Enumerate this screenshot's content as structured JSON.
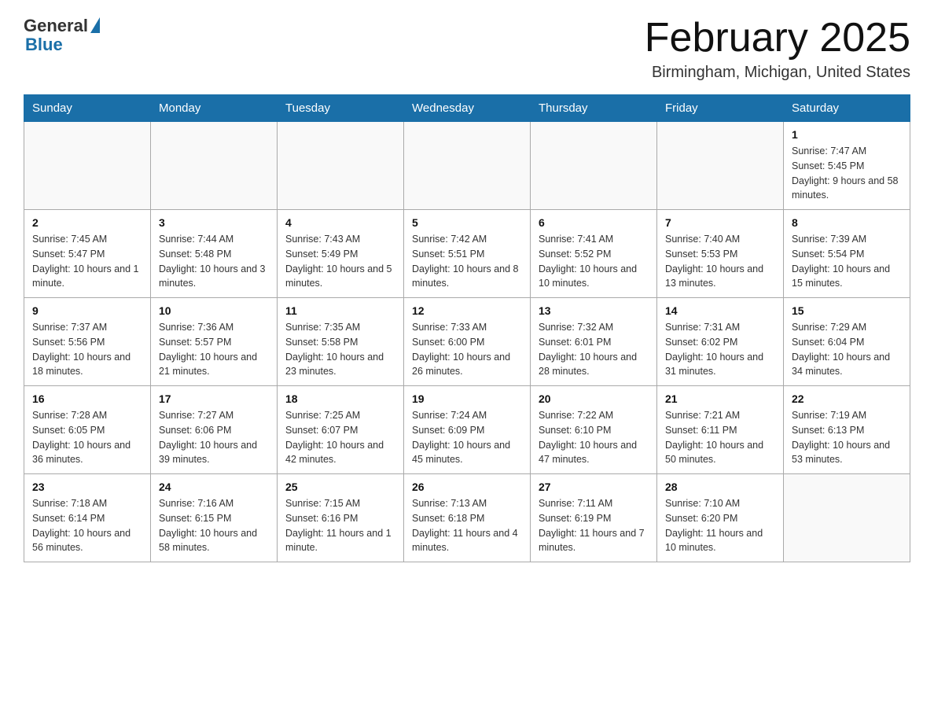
{
  "logo": {
    "general": "General",
    "blue": "Blue"
  },
  "header": {
    "month": "February 2025",
    "location": "Birmingham, Michigan, United States"
  },
  "days_of_week": [
    "Sunday",
    "Monday",
    "Tuesday",
    "Wednesday",
    "Thursday",
    "Friday",
    "Saturday"
  ],
  "weeks": [
    [
      {
        "day": "",
        "info": ""
      },
      {
        "day": "",
        "info": ""
      },
      {
        "day": "",
        "info": ""
      },
      {
        "day": "",
        "info": ""
      },
      {
        "day": "",
        "info": ""
      },
      {
        "day": "",
        "info": ""
      },
      {
        "day": "1",
        "info": "Sunrise: 7:47 AM\nSunset: 5:45 PM\nDaylight: 9 hours and 58 minutes."
      }
    ],
    [
      {
        "day": "2",
        "info": "Sunrise: 7:45 AM\nSunset: 5:47 PM\nDaylight: 10 hours and 1 minute."
      },
      {
        "day": "3",
        "info": "Sunrise: 7:44 AM\nSunset: 5:48 PM\nDaylight: 10 hours and 3 minutes."
      },
      {
        "day": "4",
        "info": "Sunrise: 7:43 AM\nSunset: 5:49 PM\nDaylight: 10 hours and 5 minutes."
      },
      {
        "day": "5",
        "info": "Sunrise: 7:42 AM\nSunset: 5:51 PM\nDaylight: 10 hours and 8 minutes."
      },
      {
        "day": "6",
        "info": "Sunrise: 7:41 AM\nSunset: 5:52 PM\nDaylight: 10 hours and 10 minutes."
      },
      {
        "day": "7",
        "info": "Sunrise: 7:40 AM\nSunset: 5:53 PM\nDaylight: 10 hours and 13 minutes."
      },
      {
        "day": "8",
        "info": "Sunrise: 7:39 AM\nSunset: 5:54 PM\nDaylight: 10 hours and 15 minutes."
      }
    ],
    [
      {
        "day": "9",
        "info": "Sunrise: 7:37 AM\nSunset: 5:56 PM\nDaylight: 10 hours and 18 minutes."
      },
      {
        "day": "10",
        "info": "Sunrise: 7:36 AM\nSunset: 5:57 PM\nDaylight: 10 hours and 21 minutes."
      },
      {
        "day": "11",
        "info": "Sunrise: 7:35 AM\nSunset: 5:58 PM\nDaylight: 10 hours and 23 minutes."
      },
      {
        "day": "12",
        "info": "Sunrise: 7:33 AM\nSunset: 6:00 PM\nDaylight: 10 hours and 26 minutes."
      },
      {
        "day": "13",
        "info": "Sunrise: 7:32 AM\nSunset: 6:01 PM\nDaylight: 10 hours and 28 minutes."
      },
      {
        "day": "14",
        "info": "Sunrise: 7:31 AM\nSunset: 6:02 PM\nDaylight: 10 hours and 31 minutes."
      },
      {
        "day": "15",
        "info": "Sunrise: 7:29 AM\nSunset: 6:04 PM\nDaylight: 10 hours and 34 minutes."
      }
    ],
    [
      {
        "day": "16",
        "info": "Sunrise: 7:28 AM\nSunset: 6:05 PM\nDaylight: 10 hours and 36 minutes."
      },
      {
        "day": "17",
        "info": "Sunrise: 7:27 AM\nSunset: 6:06 PM\nDaylight: 10 hours and 39 minutes."
      },
      {
        "day": "18",
        "info": "Sunrise: 7:25 AM\nSunset: 6:07 PM\nDaylight: 10 hours and 42 minutes."
      },
      {
        "day": "19",
        "info": "Sunrise: 7:24 AM\nSunset: 6:09 PM\nDaylight: 10 hours and 45 minutes."
      },
      {
        "day": "20",
        "info": "Sunrise: 7:22 AM\nSunset: 6:10 PM\nDaylight: 10 hours and 47 minutes."
      },
      {
        "day": "21",
        "info": "Sunrise: 7:21 AM\nSunset: 6:11 PM\nDaylight: 10 hours and 50 minutes."
      },
      {
        "day": "22",
        "info": "Sunrise: 7:19 AM\nSunset: 6:13 PM\nDaylight: 10 hours and 53 minutes."
      }
    ],
    [
      {
        "day": "23",
        "info": "Sunrise: 7:18 AM\nSunset: 6:14 PM\nDaylight: 10 hours and 56 minutes."
      },
      {
        "day": "24",
        "info": "Sunrise: 7:16 AM\nSunset: 6:15 PM\nDaylight: 10 hours and 58 minutes."
      },
      {
        "day": "25",
        "info": "Sunrise: 7:15 AM\nSunset: 6:16 PM\nDaylight: 11 hours and 1 minute."
      },
      {
        "day": "26",
        "info": "Sunrise: 7:13 AM\nSunset: 6:18 PM\nDaylight: 11 hours and 4 minutes."
      },
      {
        "day": "27",
        "info": "Sunrise: 7:11 AM\nSunset: 6:19 PM\nDaylight: 11 hours and 7 minutes."
      },
      {
        "day": "28",
        "info": "Sunrise: 7:10 AM\nSunset: 6:20 PM\nDaylight: 11 hours and 10 minutes."
      },
      {
        "day": "",
        "info": ""
      }
    ]
  ]
}
